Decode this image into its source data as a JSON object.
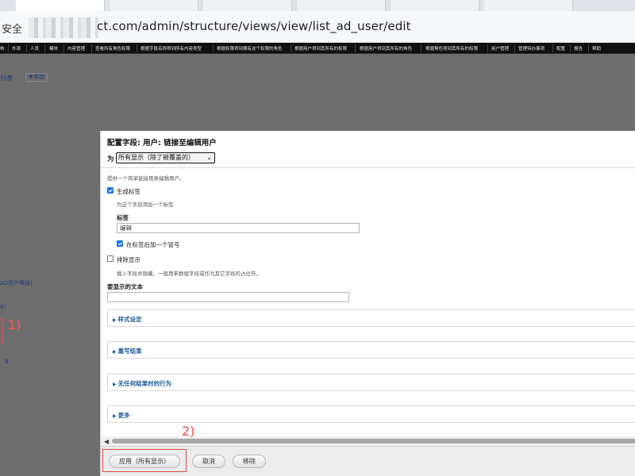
{
  "browser": {
    "tabs": [
      "",
      "",
      "",
      "",
      "",
      ""
    ],
    "security_label": "安全",
    "url": "ct.com/admin/structure/views/view/list_ad_user/edit"
  },
  "admin_menu": [
    "构",
    "外观",
    "人员",
    "模块",
    "内容管理",
    "查看所有角色权限",
    "根据字段名称得到所有内容类型",
    "根据权限得到拥有这个权限的角色",
    "根据用户得到其所有的权限",
    "根据用户得到其所有的角色",
    "根据角色得到其所有的权限",
    "用户管理",
    "管理待办事项",
    "配置",
    "报告",
    "帮助"
  ],
  "background_page": {
    "list_link": "列表",
    "add_button": "✚添加",
    "ad_text": "AD用户等级)",
    "misc_text": "B)",
    "misc_text2": "Ⅲ",
    "annotation_1": "1)"
  },
  "dialog": {
    "title": "配置字段: 用户: 链接至编辑用户",
    "for_label": "为",
    "for_select": "所有显示（除了被覆盖的）",
    "intro": "提供一个简单链接用来编辑用户。",
    "create_label_checkbox": {
      "label": "生成标签",
      "checked": true
    },
    "create_label_desc": "为这个字段添加一个标签",
    "label_field": {
      "label": "标签",
      "value": "编辑"
    },
    "colon_checkbox": {
      "label": "在标签后加一个冒号",
      "checked": true
    },
    "exclude_checkbox": {
      "label": "排除显示",
      "checked": false
    },
    "exclude_desc": "载入字段并隐藏。一般用来群组字段或作为其它字段的占位符。",
    "text_field": {
      "label": "要显示的文本",
      "value": ""
    },
    "sections": [
      "样式设定",
      "重写结果",
      "无任何结果时的行为",
      "更多"
    ],
    "buttons": {
      "apply": "应用（所有显示）",
      "cancel": "取消",
      "remove": "移除"
    },
    "annotation_2": "2)"
  },
  "colors": {
    "highlight_red": "#e04848",
    "link_blue": "#1e5a9a",
    "checkbox_blue": "#1a73e8"
  }
}
